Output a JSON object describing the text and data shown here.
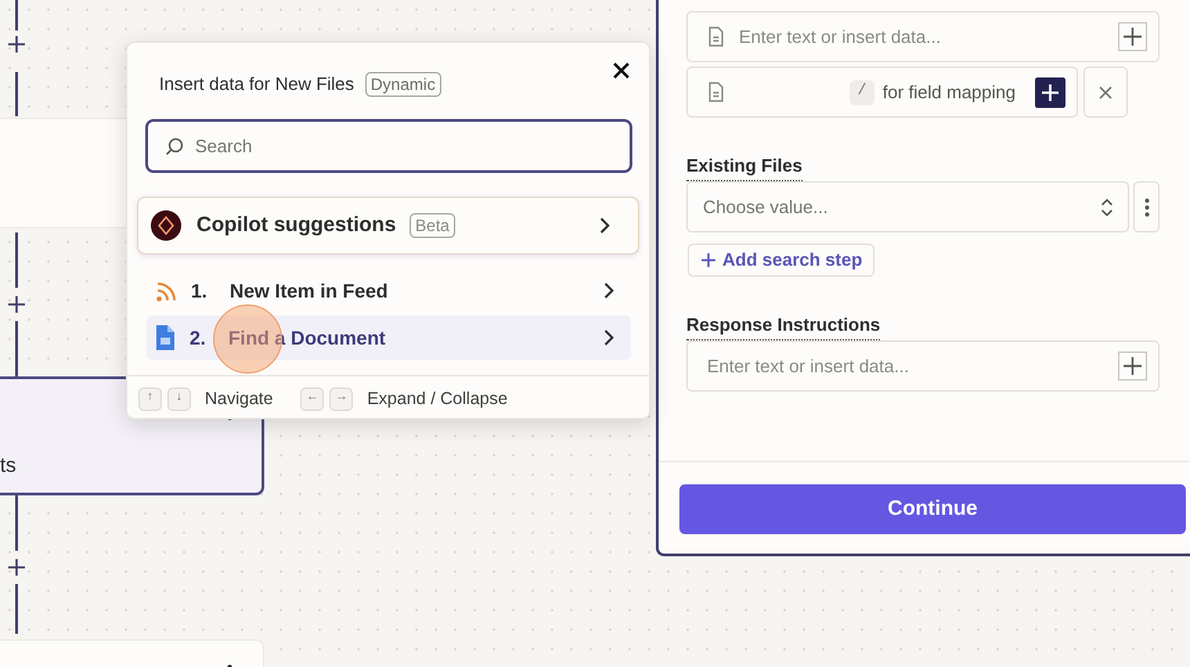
{
  "canvas": {
    "cards": [
      {
        "selected": false
      },
      {
        "selected": true,
        "text": "ts"
      },
      {
        "selected": false
      }
    ]
  },
  "popup": {
    "title": "Insert data for New Files",
    "badge": "Dynamic",
    "search": {
      "placeholder": "Search"
    },
    "copilot": {
      "label": "Copilot suggestions",
      "badge": "Beta"
    },
    "steps": [
      {
        "number": "1.",
        "label": "New Item in Feed",
        "kind": "rss",
        "selected": false
      },
      {
        "number": "2.",
        "label": "Find a Document",
        "kind": "doc",
        "selected": true
      }
    ],
    "hints": [
      {
        "keys": [
          "↑",
          "↓"
        ],
        "label": "Navigate"
      },
      {
        "keys": [
          "←",
          "→"
        ],
        "label": "Expand / Collapse"
      }
    ]
  },
  "panel": {
    "fields": [
      {
        "kind": "text",
        "placeholder": "Enter text or insert data..."
      },
      {
        "kind": "mapping",
        "key": "/",
        "hint": "for field mapping"
      }
    ],
    "existing_files": {
      "label": "Existing Files",
      "placeholder": "Choose value...",
      "add_button": "Add search step"
    },
    "response_instructions": {
      "label": "Response Instructions",
      "placeholder": "Enter text or insert data..."
    },
    "continue_button": "Continue"
  }
}
